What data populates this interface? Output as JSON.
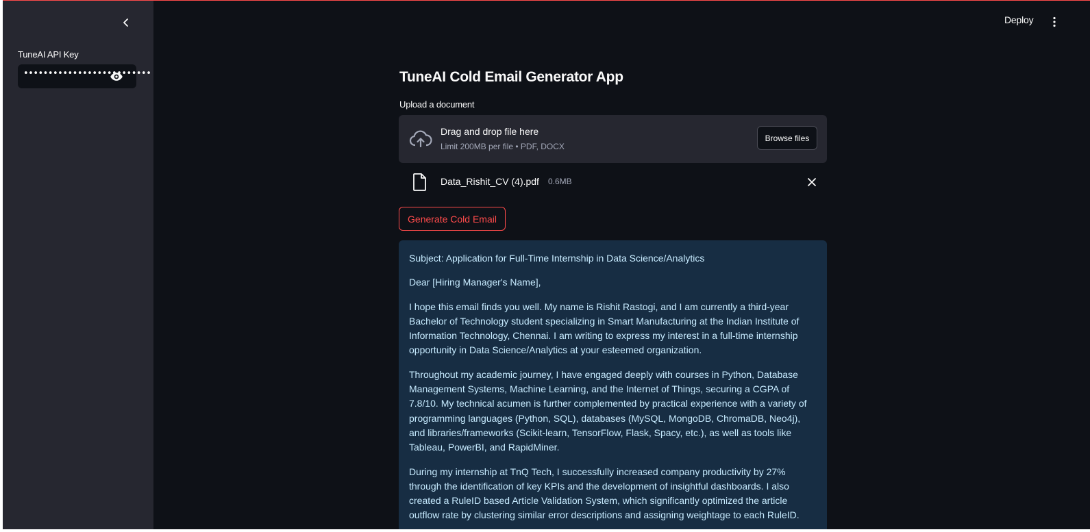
{
  "sidebar": {
    "api_key_label": "TuneAI API Key",
    "api_key_value": "••••••••••••••••••••••••••",
    "collapse_icon": "chevron-left-icon",
    "eye_icon": "eye-icon"
  },
  "header": {
    "deploy_label": "Deploy",
    "menu_icon": "kebab-menu-icon"
  },
  "main": {
    "title": "TuneAI Cold Email Generator App",
    "upload_label": "Upload a document",
    "dropzone": {
      "main_text": "Drag and drop file here",
      "sub_text": "Limit 200MB per file • PDF, DOCX",
      "browse_label": "Browse files",
      "icon": "cloud-upload-icon"
    },
    "file": {
      "name": "Data_Rishit_CV (4).pdf",
      "size": "0.6MB",
      "icon": "file-icon",
      "remove_icon": "close-icon"
    },
    "generate_label": "Generate Cold Email",
    "email_paragraphs": [
      "Subject: Application for Full-Time Internship in Data Science/Analytics",
      "Dear [Hiring Manager's Name],",
      "I hope this email finds you well. My name is Rishit Rastogi, and I am currently a third-year Bachelor of Technology student specializing in Smart Manufacturing at the Indian Institute of Information Technology, Chennai. I am writing to express my interest in a full-time internship opportunity in Data Science/Analytics at your esteemed organization.",
      "Throughout my academic journey, I have engaged deeply with courses in Python, Database Management Systems, Machine Learning, and the Internet of Things, securing a CGPA of 7.8/10. My technical acumen is further complemented by practical experience with a variety of programming languages (Python, SQL), databases (MySQL, MongoDB, ChromaDB, Neo4j), and libraries/frameworks (Scikit-learn, TensorFlow, Flask, Spacy, etc.), as well as tools like Tableau, PowerBI, and RapidMiner.",
      "During my internship at TnQ Tech, I successfully increased company productivity by 27% through the identification of key KPIs and the development of insightful dashboards. I also created a RuleID based Article Validation System, which significantly optimized the article outflow rate by clustering similar error descriptions and assigning weightage to each RuleID."
    ]
  },
  "colors": {
    "background": "#0e1117",
    "sidebar": "#262730",
    "accent": "#ff4b4b",
    "info_box": "#172d43",
    "info_text": "#c7ebff"
  }
}
